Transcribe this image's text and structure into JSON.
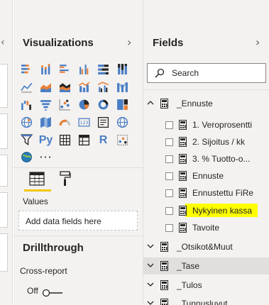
{
  "visualizations": {
    "title": "Visualizations",
    "text_icons": {
      "python": "Py",
      "r": "R"
    },
    "values_label": "Values",
    "drop_placeholder": "Add data fields here",
    "drillthrough_title": "Drillthrough",
    "cross_report_label": "Cross-report",
    "toggle_state": "Off"
  },
  "fields_pane": {
    "title": "Fields",
    "search_placeholder": "Search",
    "tables": [
      {
        "name": "_Ennuste",
        "expanded": true,
        "fields": [
          {
            "label": "1. Veroprosentti",
            "checked": false
          },
          {
            "label": "2. Sijoitus / kk",
            "checked": false
          },
          {
            "label": "3. % Tuotto-o...",
            "checked": false
          },
          {
            "label": "Ennuste",
            "checked": false
          },
          {
            "label": "Ennustettu FiRe",
            "checked": false
          },
          {
            "label": "Nykyinen kassa",
            "checked": false,
            "highlighted": true
          },
          {
            "label": "Tavoite",
            "checked": false
          }
        ]
      },
      {
        "name": "_Otsikot&Muut",
        "expanded": false
      },
      {
        "name": "_Tase",
        "expanded": false,
        "selected": true
      },
      {
        "name": "_Tulos",
        "expanded": false
      },
      {
        "name": "_Tunnusluvut",
        "expanded": false
      }
    ]
  },
  "colors": {
    "pane_bg": "#f3f2f1",
    "accent_yellow": "#f2c811",
    "highlight": "#ffff00",
    "selected_row": "#e1dfdd"
  }
}
